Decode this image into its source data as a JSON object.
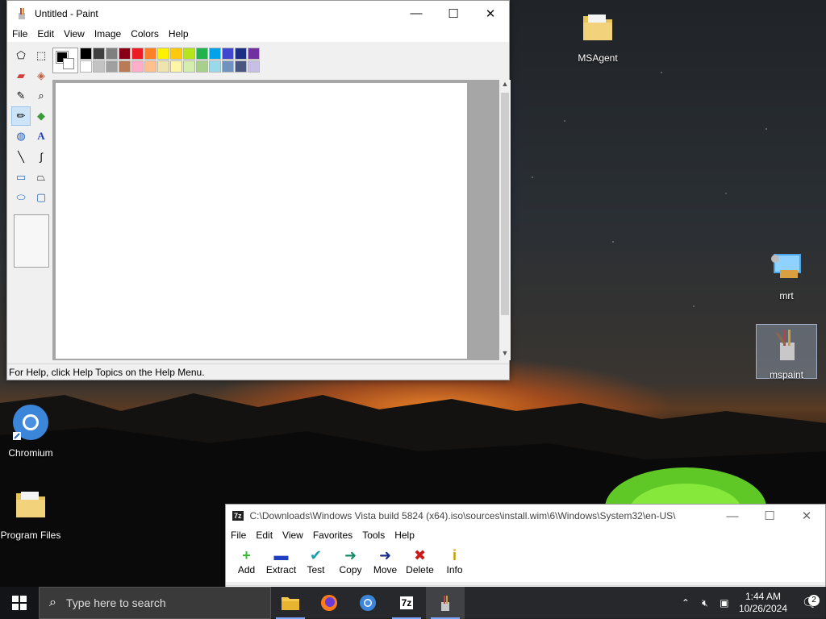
{
  "paint": {
    "title": "Untitled - Paint",
    "menu": [
      "File",
      "Edit",
      "View",
      "Image",
      "Colors",
      "Help"
    ],
    "status": "For Help, click Help Topics on the Help Menu.",
    "tools": [
      "free-select-icon",
      "rect-select-icon",
      "eraser-icon",
      "fill-icon",
      "color-picker-icon",
      "magnifier-icon",
      "pencil-icon",
      "brush-icon",
      "airbrush-icon",
      "text-icon",
      "line-icon",
      "curve-icon",
      "rectangle-icon",
      "polygon-icon",
      "ellipse-icon",
      "rounded-rect-icon"
    ],
    "active_tool": "pencil-icon",
    "palette_row1": [
      "#000000",
      "#404040",
      "#7f7f7f",
      "#880015",
      "#ed1c24",
      "#ff7f27",
      "#fff200",
      "#ffc90e",
      "#b5e61d",
      "#22b14c",
      "#00a2e8",
      "#3f48cc",
      "#1c2f85",
      "#7030a0"
    ],
    "palette_row2": [
      "#ffffff",
      "#c3c3c3",
      "#a0a0a0",
      "#b97a57",
      "#ffaec9",
      "#ffc090",
      "#efe4b0",
      "#fff5a8",
      "#d4eeb0",
      "#a8d08d",
      "#99d9ea",
      "#7092be",
      "#4a5680",
      "#c8bfe7"
    ]
  },
  "zip": {
    "title": "C:\\Downloads\\Windows Vista build 5824 (x64).iso\\sources\\install.wim\\6\\Windows\\System32\\en-US\\",
    "menu": [
      "File",
      "Edit",
      "View",
      "Favorites",
      "Tools",
      "Help"
    ],
    "buttons": [
      {
        "label": "Add",
        "icon": "add-icon",
        "glyph": "+",
        "color": "#2fbf2f"
      },
      {
        "label": "Extract",
        "icon": "extract-icon",
        "glyph": "▬",
        "color": "#1f3fbf"
      },
      {
        "label": "Test",
        "icon": "test-icon",
        "glyph": "✔",
        "color": "#18a0b0"
      },
      {
        "label": "Copy",
        "icon": "copy-icon",
        "glyph": "➜",
        "color": "#148a6a"
      },
      {
        "label": "Move",
        "icon": "move-icon",
        "glyph": "➜",
        "color": "#1a2a8a"
      },
      {
        "label": "Delete",
        "icon": "delete-icon",
        "glyph": "✖",
        "color": "#d01818"
      },
      {
        "label": "Info",
        "icon": "info-icon",
        "glyph": "i",
        "color": "#c8a000"
      }
    ]
  },
  "desktop": {
    "icons": [
      {
        "label": "MSAgent",
        "icon": "folder-icon"
      },
      {
        "label": "mrt",
        "icon": "mrt-icon"
      },
      {
        "label": "mspaint",
        "icon": "mspaint-icon"
      },
      {
        "label": "Chromium",
        "icon": "chromium-icon"
      },
      {
        "label": "Program Files",
        "icon": "folder-icon"
      }
    ]
  },
  "taskbar": {
    "search_placeholder": "Type here to search",
    "time": "1:44 AM",
    "date": "10/26/2024",
    "notifications": "2"
  }
}
